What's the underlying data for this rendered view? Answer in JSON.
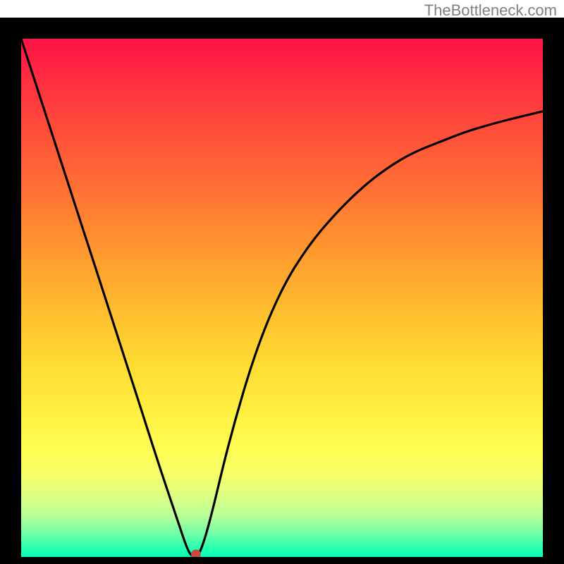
{
  "watermark": "TheBottleneck.com",
  "chart_data": {
    "type": "line",
    "title": "",
    "xlabel": "",
    "ylabel": "",
    "xlim": [
      0,
      100
    ],
    "ylim": [
      0,
      100
    ],
    "grid": false,
    "background_gradient": {
      "top": "#ff1245",
      "bottom": "#00ffb5",
      "note": "vertical red→orange→yellow→green"
    },
    "series": [
      {
        "name": "curve",
        "x": [
          0,
          10,
          20,
          26,
          30,
          32,
          33,
          34,
          36,
          40,
          45,
          50,
          55,
          60,
          65,
          70,
          75,
          80,
          85,
          90,
          95,
          100
        ],
        "y": [
          100,
          69,
          38,
          19,
          7,
          1,
          0,
          0,
          6,
          23,
          40,
          52,
          60,
          66,
          71,
          75,
          78,
          80,
          82,
          83.5,
          84.8,
          86
        ]
      }
    ],
    "marker": {
      "x": 33.5,
      "y": 0,
      "color": "#c84a3c"
    }
  }
}
